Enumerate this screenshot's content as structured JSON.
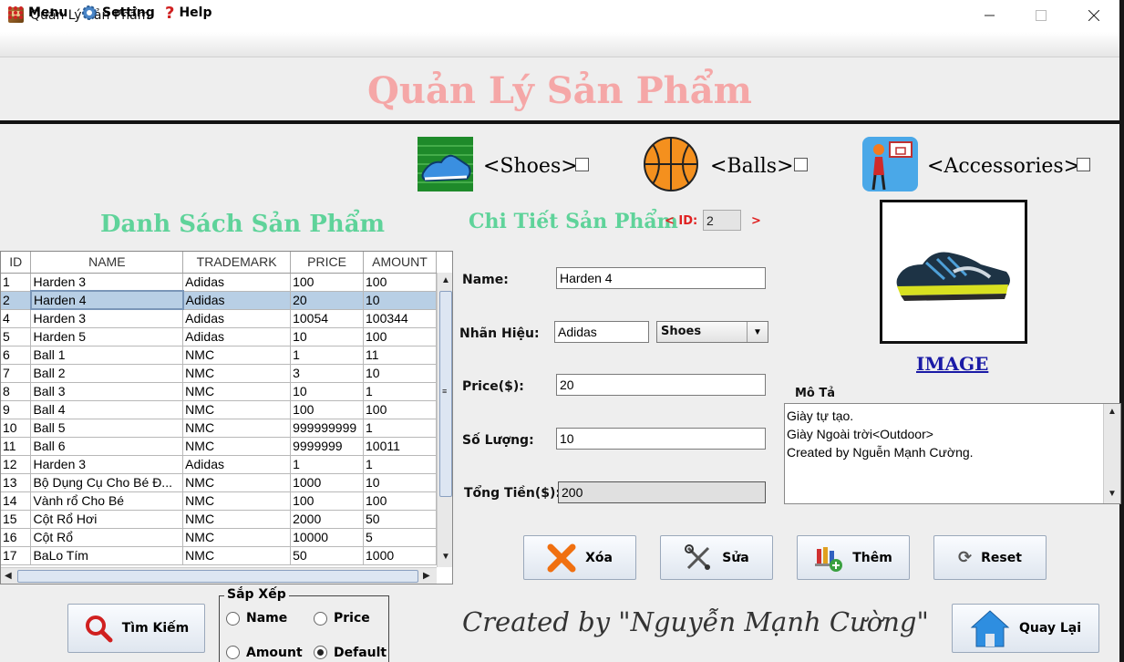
{
  "window": {
    "title": "Quản Lý Sản Phẩm"
  },
  "menubar": {
    "menu": "Menu",
    "setting": "Setting",
    "help": "Help"
  },
  "header": {
    "title": "Quản Lý Sản Phẩm"
  },
  "categories": {
    "shoes": "<Shoes>",
    "balls": "<Balls>",
    "accessories": "<Accessories>"
  },
  "list": {
    "title": "Danh Sách Sản Phẩm",
    "columns": [
      "ID",
      "NAME",
      "TRADEMARK",
      "PRICE",
      "AMOUNT"
    ],
    "rows": [
      [
        "1",
        "Harden 3",
        "Adidas",
        "100",
        "100"
      ],
      [
        "2",
        "Harden 4",
        "Adidas",
        "20",
        "10"
      ],
      [
        "4",
        "Harden 3",
        "Adidas",
        "10054",
        "100344"
      ],
      [
        "5",
        "Harden 5",
        "Adidas",
        "10",
        "100"
      ],
      [
        "6",
        "Ball 1",
        "NMC",
        "1",
        "11"
      ],
      [
        "7",
        "Ball 2",
        "NMC",
        "3",
        "10"
      ],
      [
        "8",
        "Ball 3",
        "NMC",
        "10",
        "1"
      ],
      [
        "9",
        "Ball 4",
        "NMC",
        "100",
        "100"
      ],
      [
        "10",
        "Ball 5",
        "NMC",
        "999999999",
        "1"
      ],
      [
        "11",
        "Ball 6",
        "NMC",
        "9999999",
        "10011"
      ],
      [
        "12",
        "Harden 3",
        "Adidas",
        "1",
        "1"
      ],
      [
        "13",
        "Bộ Dụng Cụ Cho Bé Đ...",
        "NMC",
        "1000",
        "10"
      ],
      [
        "14",
        "Vành rổ Cho Bé",
        "NMC",
        "100",
        "100"
      ],
      [
        "15",
        "Cột Rổ Hơi",
        "NMC",
        "2000",
        "50"
      ],
      [
        "16",
        "Cột Rổ",
        "NMC",
        "10000",
        "5"
      ],
      [
        "17",
        "BaLo Tím",
        "NMC",
        "50",
        "1000"
      ]
    ],
    "selected_row": 1
  },
  "detail": {
    "title": "Chi Tiết Sản Phẩm",
    "id_open": "< ID:",
    "id_value": "2",
    "id_close": ">",
    "name_label": "Name:",
    "name_value": "Harden 4",
    "brand_label": "Nhãn Hiệu:",
    "brand_value": "Adidas",
    "category_value": "Shoes",
    "price_label": "Price($):",
    "price_value": "20",
    "qty_label": "Số Lượng:",
    "qty_value": "10",
    "total_label": "Tổng Tiền($):",
    "total_value": "200"
  },
  "image": {
    "link": "IMAGE"
  },
  "description": {
    "label": "Mô Tả",
    "lines": [
      "Giày tự tạo.",
      "Giày Ngoài trời<Outdoor>",
      "Created by Nguễn Mạnh Cường."
    ]
  },
  "actions": {
    "delete": "Xóa",
    "edit": "Sửa",
    "add": "Thêm",
    "reset": "Reset"
  },
  "search": {
    "label": "Tìm Kiếm"
  },
  "sort": {
    "title": "Sắp Xếp",
    "options": [
      "Name",
      "Price",
      "Amount",
      "Default"
    ],
    "selected": "Default"
  },
  "footer": {
    "credit": "Created by \"Nguyễn Mạnh Cường\"",
    "back": "Quay Lại"
  },
  "colors": {
    "header_title": "#f5a7a7",
    "section_title": "#5fd39a",
    "id_label": "#e02020",
    "selection": "#b8cfe5"
  }
}
